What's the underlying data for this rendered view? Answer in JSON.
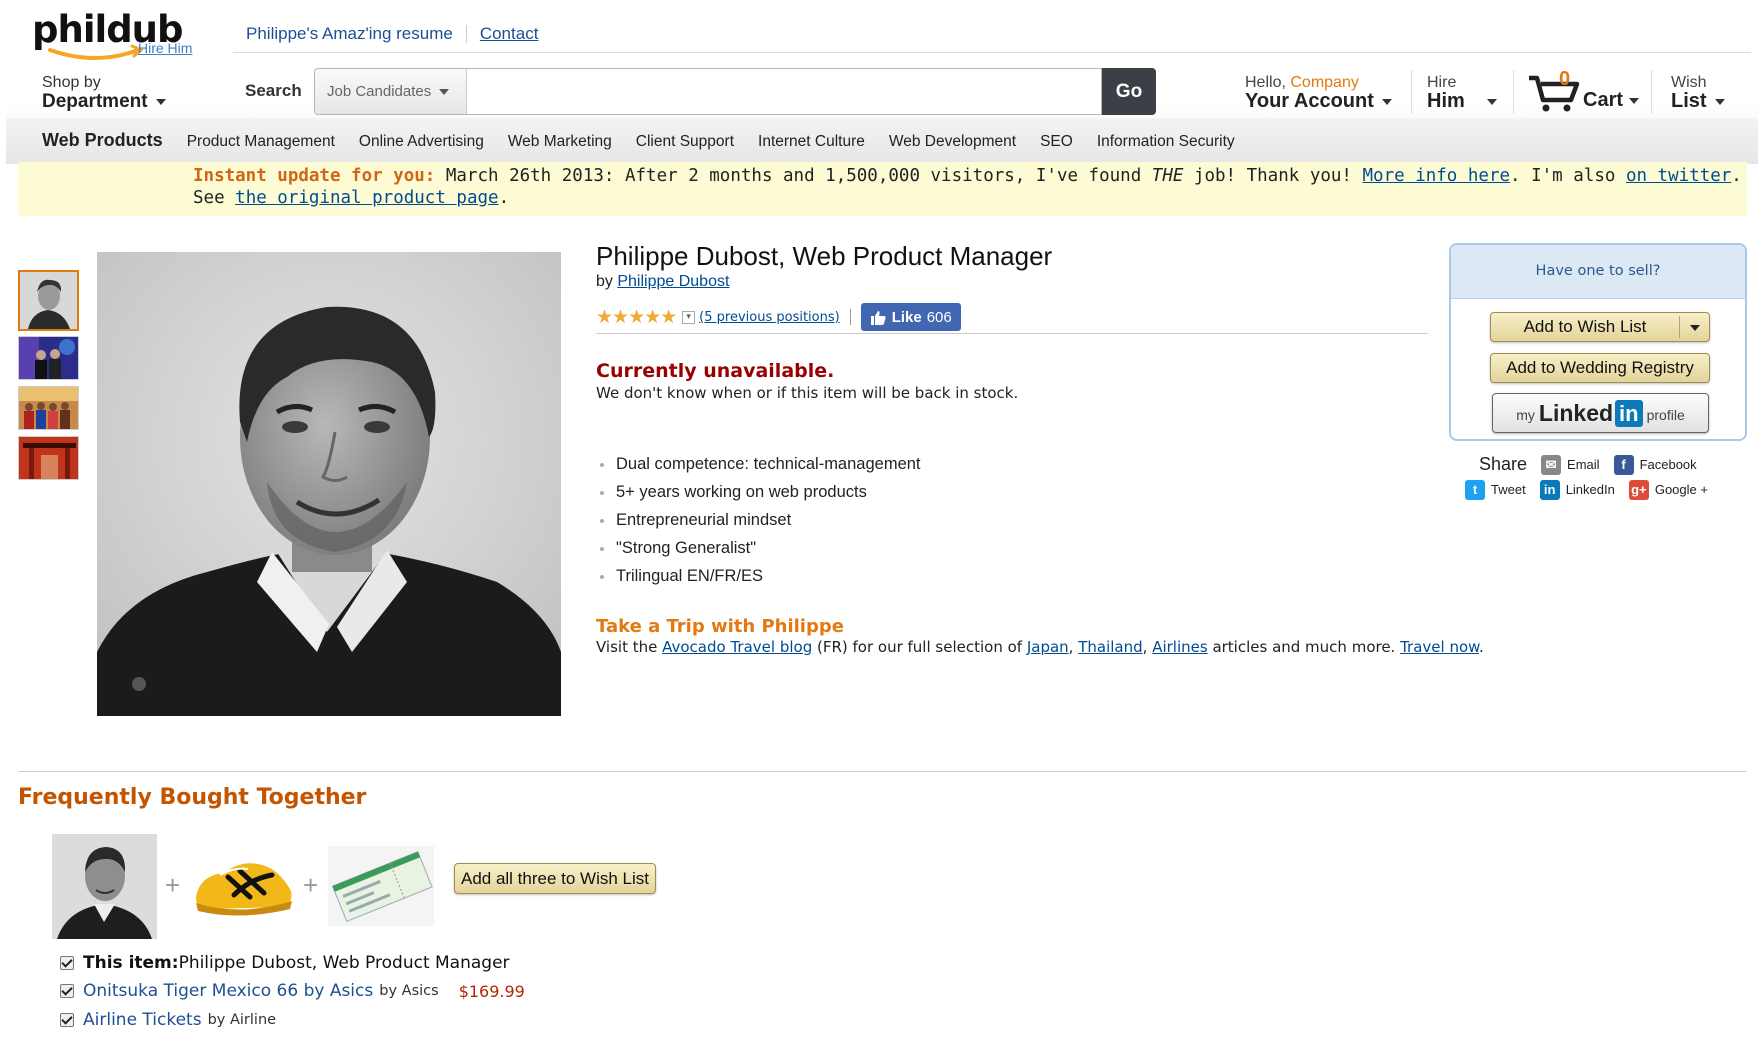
{
  "logo": {
    "text": "phildub",
    "tagline": "Hire Him"
  },
  "top_links": {
    "resume": "Philippe's Amaz'ing resume",
    "contact": "Contact"
  },
  "nav": {
    "shop_by_small": "Shop by",
    "shop_by_big": "Department",
    "search_label": "Search",
    "search_scope": "Job Candidates",
    "search_placeholder": "",
    "go": "Go",
    "hello_prefix": "Hello, ",
    "hello_name": "Company",
    "your_account": "Your Account",
    "hire_small": "Hire",
    "hire_big": "Him",
    "cart_count": "0",
    "cart": "Cart",
    "wish_small": "Wish",
    "wish_big": "List"
  },
  "categories": {
    "first": "Web Products",
    "items": [
      "Product Management",
      "Online Advertising",
      "Web Marketing",
      "Client Support",
      "Internet Culture",
      "Web Development",
      "SEO",
      "Information Security"
    ]
  },
  "banner": {
    "highlight": "Instant update for you:",
    "text1": " March 26th 2013: After 2 months and 1,500,000 visitors, I've found ",
    "emph": "THE",
    "text2": " job! Thank you! ",
    "more_info": "More info here",
    "text3": ". I'm also ",
    "twitter": "on twitter",
    "text4": ".",
    "see": "See ",
    "original": "the original product page",
    "period": "."
  },
  "product": {
    "title": "Philippe Dubost, Web Product Manager",
    "by": "by ",
    "author": "Philippe Dubost",
    "stars": "★★★★★",
    "stars_dropdown": "▾",
    "prev_positions": "(5 previous positions)",
    "like": "Like",
    "like_count": "606",
    "unavailable": "Currently unavailable.",
    "unavailable_note": "We don't know when or if this item will be back in stock.",
    "features": [
      "Dual competence: technical-management",
      "5+ years working on web products",
      "Entrepreneurial mindset",
      "\"Strong Generalist\"",
      "Trilingual EN/FR/ES"
    ],
    "trip_title": "Take a Trip with Philippe",
    "trip": {
      "t1": "Visit the ",
      "blog": "Avocado Travel blog",
      "t2": " (FR) for our full selection of ",
      "japan": "Japan",
      "comma1": ", ",
      "thailand": "Thailand",
      "comma2": ", ",
      "airlines": "Airlines",
      "t3": " articles and much more. ",
      "travel_now": "Travel now",
      "t4": "."
    }
  },
  "buybox": {
    "head": "Have one to sell?",
    "wish": "Add to Wish List",
    "registry": "Add to Wedding Registry",
    "li_my": "my",
    "li_linked": "Linked",
    "li_in": "in",
    "li_profile": "profile"
  },
  "share": {
    "label": "Share",
    "email": "Email",
    "facebook": "Facebook",
    "tweet": "Tweet",
    "linkedin": "LinkedIn",
    "google": "Google +"
  },
  "fbt": {
    "title": "Frequently Bought Together",
    "plus": "+",
    "add_all": "Add all three to Wish List",
    "r1_label": "This item:",
    "r1_name": " Philippe Dubost, Web Product Manager",
    "r2_name": "Onitsuka Tiger Mexico 66 by Asics",
    "r2_by": "by Asics",
    "r2_price": "$169.99",
    "r3_name": "Airline Tickets",
    "r3_by": "by Airline"
  },
  "colors": {
    "accent_orange": "#e47911",
    "link_blue": "#004b91",
    "unavailable_red": "#990000",
    "banner_bg": "#fdfbd3",
    "facebook_blue": "#4267b2",
    "linkedin_blue": "#0a7ab8"
  }
}
